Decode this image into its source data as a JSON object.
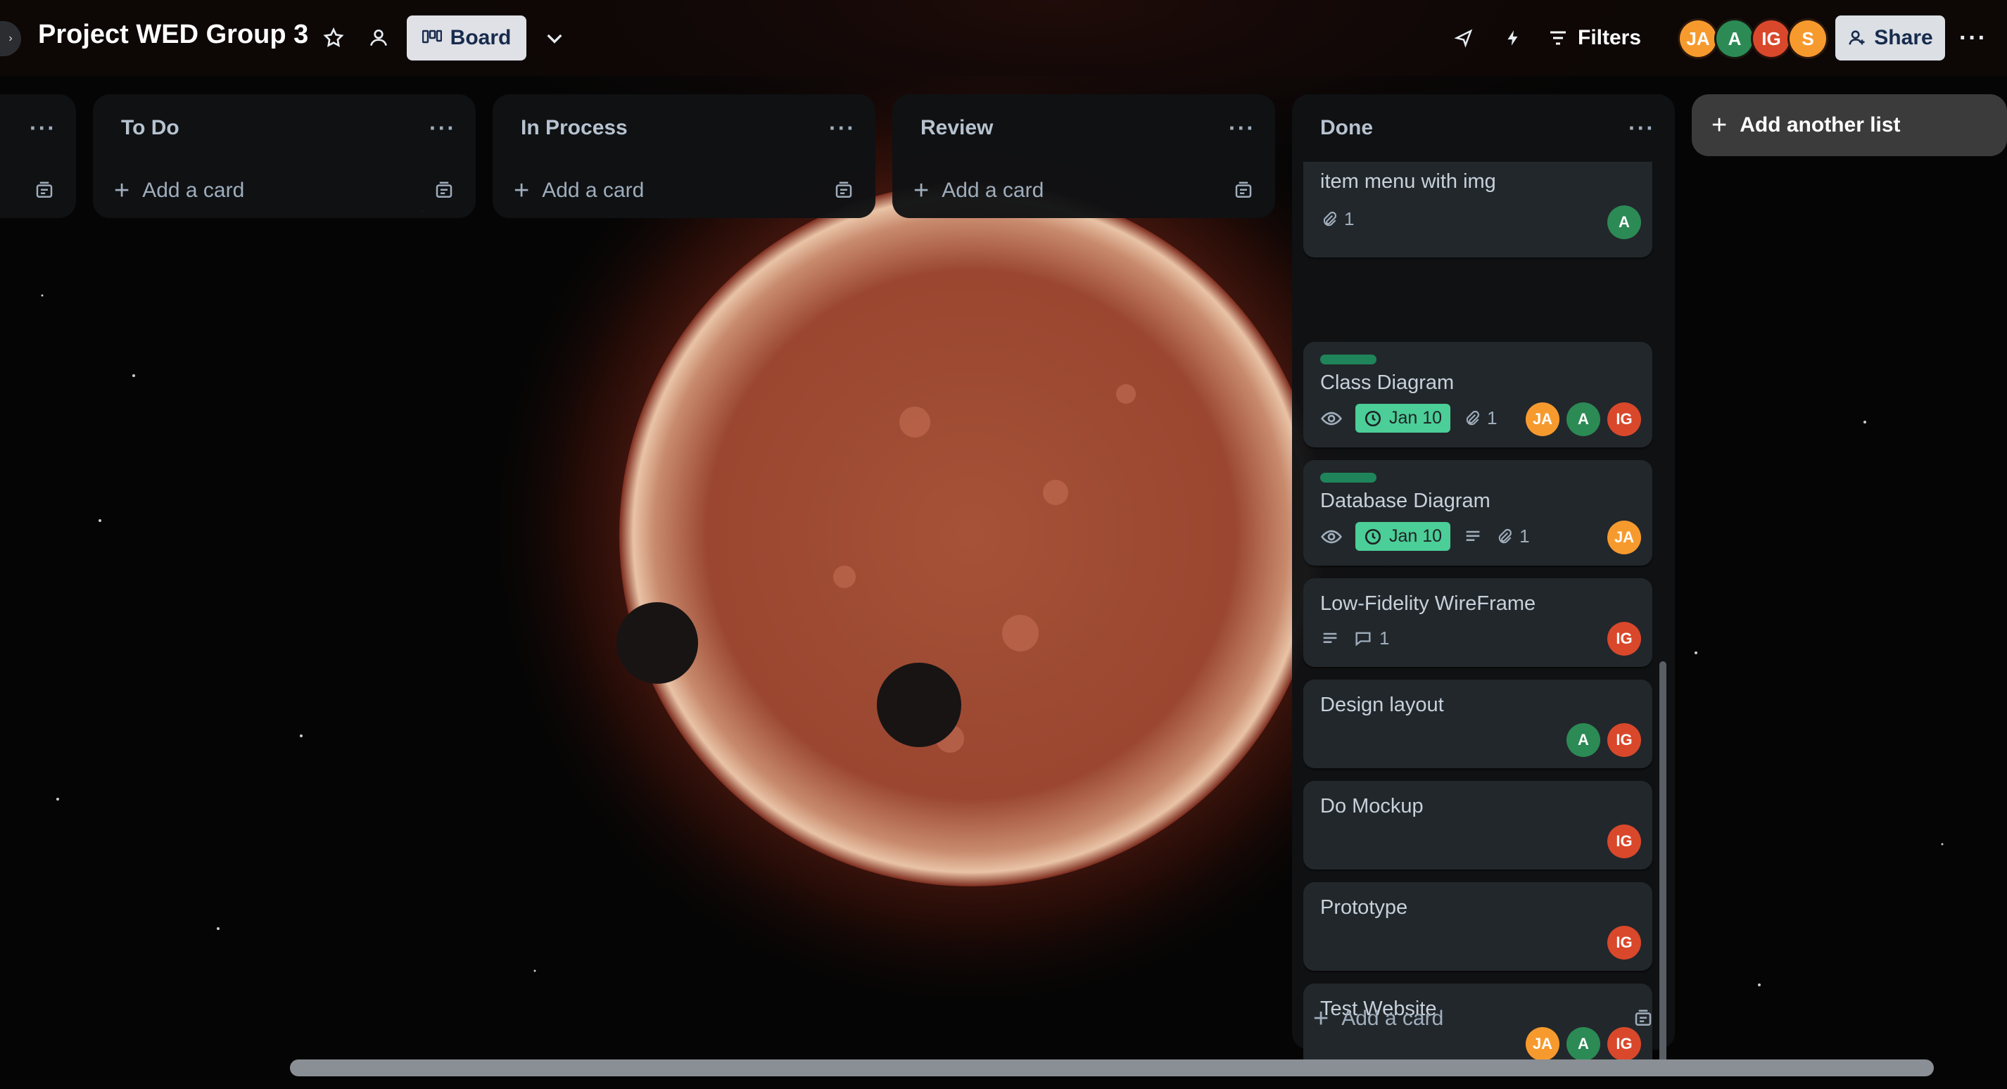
{
  "colors": {
    "due_badge": "#4bce97",
    "label_green": "#1f845a",
    "card_bg": "#22272b",
    "list_bg": "#101214",
    "avatar_ja": "#f79a2e",
    "avatar_a": "#2c8a55",
    "avatar_ig": "#d9482b",
    "avatar_s": "#f79a2e"
  },
  "header": {
    "title": "Project WED Group 3",
    "board_label": "Board",
    "filters_label": "Filters",
    "share_label": "Share",
    "members": [
      "JA",
      "A",
      "IG",
      "S"
    ],
    "icons": [
      "star-icon",
      "workspace-visibility-icon",
      "board-icon",
      "chevron-down-icon",
      "power-up-icon",
      "automation-icon",
      "filter-icon",
      "more-icon"
    ]
  },
  "lists": [
    {
      "title": "To Do",
      "add_label": "Add a card"
    },
    {
      "title": "In Process",
      "add_label": "Add a card"
    },
    {
      "title": "Review",
      "add_label": "Add a card"
    }
  ],
  "done": {
    "title": "Done",
    "add_label": "Add a card",
    "cards": [
      {
        "title": "item menu with img",
        "attachments": "1",
        "members": [
          "A"
        ]
      },
      {
        "title": "Class Diagram",
        "due": "Jan 10",
        "attachments": "1",
        "members": [
          "JA",
          "A",
          "IG"
        ]
      },
      {
        "title": "Database Diagram",
        "due": "Jan 10",
        "attachments": "1",
        "members": [
          "JA"
        ]
      },
      {
        "title": "Low-Fidelity WireFrame",
        "comments": "1",
        "members": [
          "IG"
        ]
      },
      {
        "title": "Design layout",
        "members": [
          "A",
          "IG"
        ]
      },
      {
        "title": "Do Mockup",
        "members": [
          "IG"
        ]
      },
      {
        "title": "Prototype",
        "members": [
          "IG"
        ]
      },
      {
        "title": "Test Website",
        "members": [
          "JA",
          "A",
          "IG"
        ]
      }
    ]
  },
  "add_list_label": "Add another list"
}
